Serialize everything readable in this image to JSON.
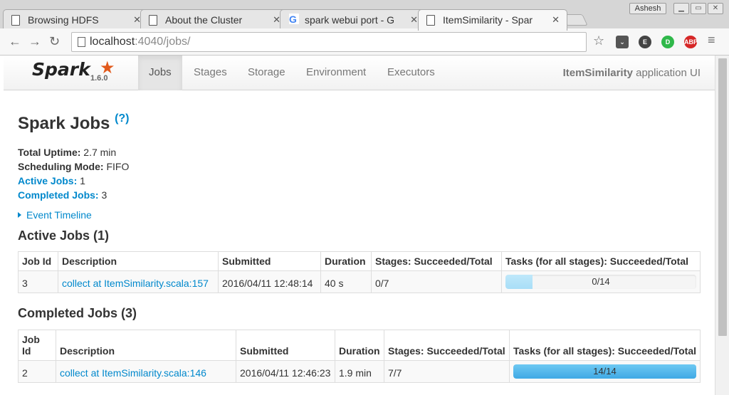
{
  "browser": {
    "tabs": [
      {
        "title": "Browsing HDFS",
        "icon": "page-icon"
      },
      {
        "title": "About the Cluster",
        "icon": "page-icon"
      },
      {
        "title": "spark webui port - G",
        "icon": "google-icon"
      },
      {
        "title": "ItemSimilarity - Spar",
        "icon": "page-icon",
        "active": true
      }
    ],
    "user": "Ashesh",
    "url_host": "localhost",
    "url_path": ":4040/jobs/"
  },
  "navbar": {
    "brand": "Spark",
    "version": "1.6.0",
    "links": [
      "Jobs",
      "Stages",
      "Storage",
      "Environment",
      "Executors"
    ],
    "active": "Jobs",
    "app_name": "ItemSimilarity",
    "app_suffix": " application UI"
  },
  "page": {
    "title": "Spark Jobs",
    "help": "(?)",
    "summary": {
      "uptime_label": "Total Uptime:",
      "uptime_value": " 2.7 min",
      "mode_label": "Scheduling Mode:",
      "mode_value": " FIFO",
      "active_label": "Active Jobs:",
      "active_value": " 1",
      "completed_label": "Completed Jobs:",
      "completed_value": " 3"
    },
    "timeline": "Event Timeline"
  },
  "active_jobs": {
    "heading": "Active Jobs (1)",
    "columns": [
      "Job Id",
      "Description",
      "Submitted",
      "Duration",
      "Stages: Succeeded/Total",
      "Tasks (for all stages): Succeeded/Total"
    ],
    "rows": [
      {
        "id": "3",
        "description": "collect at ItemSimilarity.scala:157",
        "submitted": "2016/04/11 12:48:14",
        "duration": "40 s",
        "stages": "0/7",
        "tasks": "0/14",
        "progress": 0.0,
        "running": 0.14
      }
    ]
  },
  "completed_jobs": {
    "heading": "Completed Jobs (3)",
    "columns": [
      "Job Id",
      "Description",
      "Submitted",
      "Duration",
      "Stages: Succeeded/Total",
      "Tasks (for all stages): Succeeded/Total"
    ],
    "rows": [
      {
        "id": "2",
        "description": "collect at ItemSimilarity.scala:146",
        "submitted": "2016/04/11 12:46:23",
        "duration": "1.9 min",
        "stages": "7/7",
        "tasks": "14/14",
        "progress": 1.0
      }
    ]
  },
  "colors": {
    "link": "#0088cc",
    "spark_orange": "#e25a1c",
    "progress": "#3fa9e5"
  }
}
